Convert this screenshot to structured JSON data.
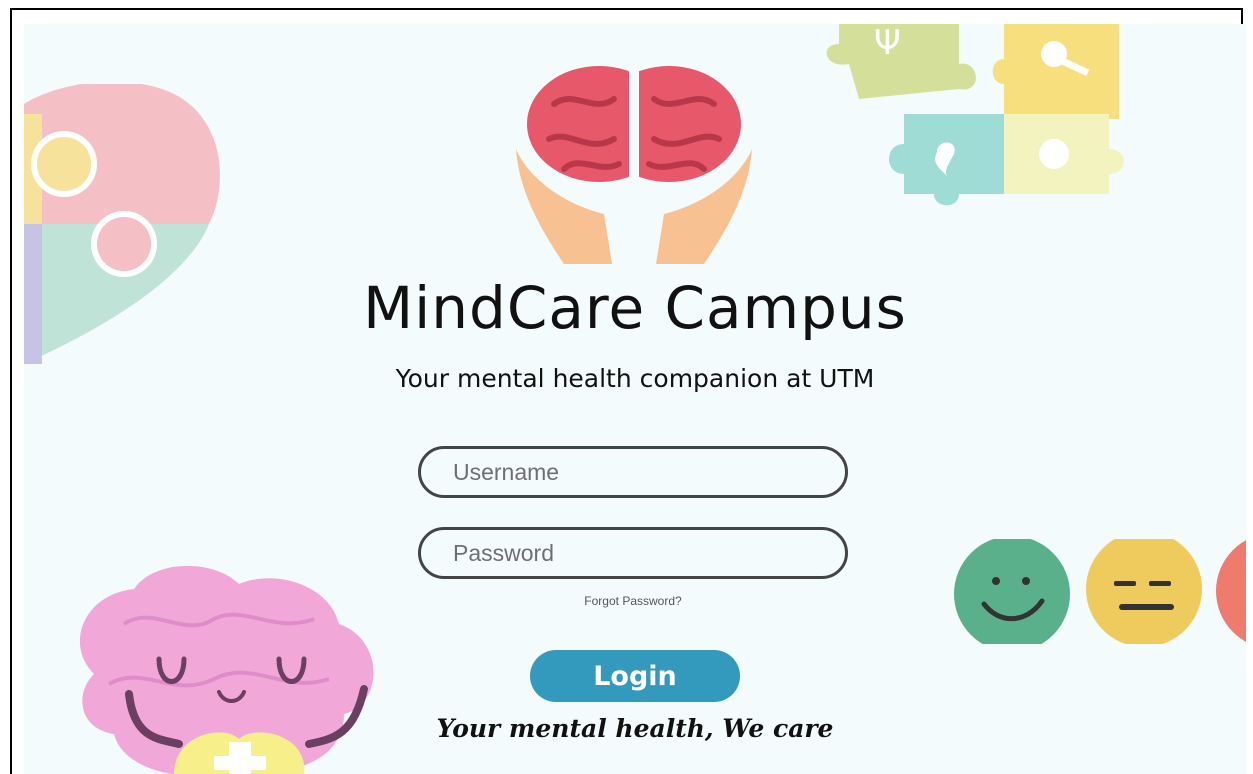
{
  "app": {
    "title": "MindCare Campus",
    "tagline": "Your mental health companion at UTM",
    "slogan": "Your mental health, We care"
  },
  "login_form": {
    "username_placeholder": "Username",
    "password_placeholder": "Password",
    "forgot_password_label": "Forgot Password?",
    "login_label": "Login"
  },
  "theme": {
    "background": "#f4fbfc",
    "login_button": "#3399bd",
    "field_border": "#444444"
  },
  "decorations": {
    "logo_icon": "brain-in-hands-icon",
    "heart_puzzle": "heart-puzzle-icon",
    "puzzle_pieces": "puzzle-pieces-icon",
    "mood_faces": [
      "happy-face-icon",
      "neutral-face-icon",
      "sad-face-icon"
    ],
    "meditating_brain": "meditating-brain-icon"
  }
}
